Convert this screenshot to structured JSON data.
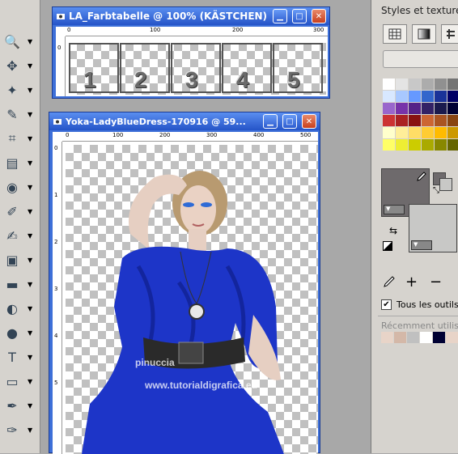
{
  "toolbar": {
    "tools": [
      {
        "name": "zoom-tool",
        "icon": "magnifier"
      },
      {
        "name": "move-tool",
        "icon": "move-arrows"
      },
      {
        "name": "magic-wand-tool",
        "icon": "wand"
      },
      {
        "name": "dropper-tool",
        "icon": "dropper"
      },
      {
        "name": "crop-tool",
        "icon": "crop"
      },
      {
        "name": "picture-tube-tool",
        "icon": "tube"
      },
      {
        "name": "red-eye-tool",
        "icon": "eye"
      },
      {
        "name": "clone-brush-tool",
        "icon": "clone-brush"
      },
      {
        "name": "paint-brush-tool",
        "icon": "brush"
      },
      {
        "name": "image-tool",
        "icon": "image"
      },
      {
        "name": "eraser-tool",
        "icon": "eraser"
      },
      {
        "name": "flood-fill-tool",
        "icon": "flood-fill"
      },
      {
        "name": "pen-object-tool",
        "icon": "pin"
      },
      {
        "name": "text-tool",
        "icon": "T"
      },
      {
        "name": "preset-shape-tool",
        "icon": "rectangle"
      },
      {
        "name": "pen-tool",
        "icon": "pen"
      },
      {
        "name": "warp-brush-tool",
        "icon": "warp"
      }
    ]
  },
  "palette": {
    "title": "Styles et textures",
    "tous_les_outils": "Tous les outils",
    "recent_label": "Récemment utilisé",
    "foreground_color": "#6e6a6c",
    "background_color": "#c8c8c6",
    "swatches": [
      "#ffffff",
      "#e4e4e4",
      "#c8c8c8",
      "#acacac",
      "#909090",
      "#747474",
      "#d8e8ff",
      "#a8c8ff",
      "#6699ff",
      "#3366cc",
      "#1a3399",
      "#000066",
      "#9966cc",
      "#7733aa",
      "#552288",
      "#332266",
      "#1a1a4d",
      "#000033",
      "#cc3333",
      "#aa2222",
      "#881111",
      "#cc6633",
      "#aa5522",
      "#884411",
      "#ffffcc",
      "#ffee99",
      "#ffdd66",
      "#ffcc33",
      "#ffbb00",
      "#cc9900",
      "#ffff66",
      "#eeee33",
      "#cccc00",
      "#aaaa00",
      "#888800",
      "#666600"
    ],
    "recent_colors": [
      "#e8d4c8",
      "#d4b8a8",
      "#c0c0c0",
      "#ffffff",
      "#000033",
      "#e8d4c8",
      "#d4b8a8"
    ]
  },
  "win_farbtabelle": {
    "title": "LA_Farbtabelle @ 100% (KÄSTCHEN)",
    "ruler_h": [
      "0",
      "100",
      "200",
      "300"
    ],
    "ruler_v": [
      "0"
    ],
    "cells": [
      "1",
      "2",
      "3",
      "4",
      "5"
    ]
  },
  "win_yoka": {
    "title": "Yoka-LadyBlueDress-170916 @  59...",
    "ruler_h": [
      "0",
      "100",
      "200",
      "300",
      "400",
      "500"
    ],
    "ruler_v": [
      "0",
      "1",
      "2",
      "3",
      "4",
      "5"
    ],
    "watermark1": "pinuccia",
    "watermark2": "www.tutorialdigrafica.eu"
  }
}
